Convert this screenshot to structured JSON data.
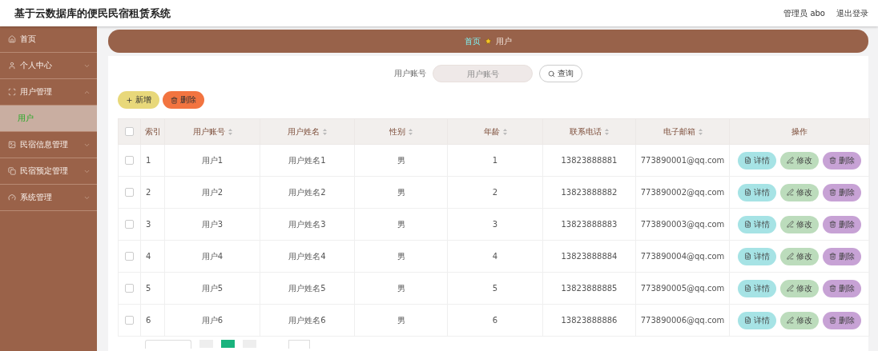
{
  "header": {
    "title": "基于云数据库的便民民宿租赁系统",
    "user": "管理员 abo",
    "logout": "退出登录"
  },
  "sidebar": {
    "items": [
      {
        "label": "首页"
      },
      {
        "label": "个人中心",
        "expanded": false
      },
      {
        "label": "用户管理",
        "expanded": true,
        "children": [
          {
            "label": "用户",
            "selected": true
          }
        ]
      },
      {
        "label": "民宿信息管理",
        "expanded": false
      },
      {
        "label": "民宿预定管理",
        "expanded": false
      },
      {
        "label": "系统管理",
        "expanded": false
      }
    ]
  },
  "breadcrumb": {
    "home": "首页",
    "current": "用户"
  },
  "search": {
    "label": "用户账号",
    "placeholder": "用户账号",
    "button": "查询"
  },
  "actions": {
    "add": "新增",
    "delete": "删除"
  },
  "table": {
    "columns": [
      {
        "label": "索引",
        "sortable": false
      },
      {
        "label": "用户账号",
        "sortable": true
      },
      {
        "label": "用户姓名",
        "sortable": true
      },
      {
        "label": "性别",
        "sortable": true
      },
      {
        "label": "年龄",
        "sortable": true
      },
      {
        "label": "联系电话",
        "sortable": true
      },
      {
        "label": "电子邮箱",
        "sortable": true
      },
      {
        "label": "操作",
        "sortable": false
      }
    ],
    "all_checked": false,
    "rows": [
      {
        "checked": false,
        "cells": [
          "1",
          "用户1",
          "用户姓名1",
          "男",
          "1",
          "13823888881",
          "773890001@qq.com"
        ],
        "actions": [
          {
            "kind": "detail",
            "label": "详情"
          },
          {
            "kind": "edit",
            "label": "修改"
          },
          {
            "kind": "delete",
            "label": "删除"
          }
        ]
      },
      {
        "checked": false,
        "cells": [
          "2",
          "用户2",
          "用户姓名2",
          "男",
          "2",
          "13823888882",
          "773890002@qq.com"
        ],
        "actions": [
          {
            "kind": "detail",
            "label": "详情"
          },
          {
            "kind": "edit",
            "label": "修改"
          },
          {
            "kind": "delete",
            "label": "删除"
          }
        ]
      },
      {
        "checked": false,
        "cells": [
          "3",
          "用户3",
          "用户姓名3",
          "男",
          "3",
          "13823888883",
          "773890003@qq.com"
        ],
        "actions": [
          {
            "kind": "detail",
            "label": "详情"
          },
          {
            "kind": "edit",
            "label": "修改"
          },
          {
            "kind": "delete",
            "label": "删除"
          }
        ]
      },
      {
        "checked": false,
        "cells": [
          "4",
          "用户4",
          "用户姓名4",
          "男",
          "4",
          "13823888884",
          "773890004@qq.com"
        ],
        "actions": [
          {
            "kind": "detail",
            "label": "详情"
          },
          {
            "kind": "edit",
            "label": "修改"
          },
          {
            "kind": "delete",
            "label": "删除"
          }
        ]
      },
      {
        "checked": false,
        "cells": [
          "5",
          "用户5",
          "用户姓名5",
          "男",
          "5",
          "13823888885",
          "773890005@qq.com"
        ],
        "actions": [
          {
            "kind": "detail",
            "label": "详情"
          },
          {
            "kind": "edit",
            "label": "修改"
          },
          {
            "kind": "delete",
            "label": "删除"
          }
        ]
      },
      {
        "checked": false,
        "cells": [
          "6",
          "用户6",
          "用户姓名6",
          "男",
          "6",
          "13823888886",
          "773890006@qq.com"
        ],
        "actions": [
          {
            "kind": "detail",
            "label": "详情"
          },
          {
            "kind": "edit",
            "label": "修改"
          },
          {
            "kind": "delete",
            "label": "删除"
          }
        ]
      }
    ]
  },
  "pagination": {
    "pages": [
      {
        "selected": false
      },
      {
        "selected": true
      },
      {
        "selected": false
      }
    ]
  }
}
